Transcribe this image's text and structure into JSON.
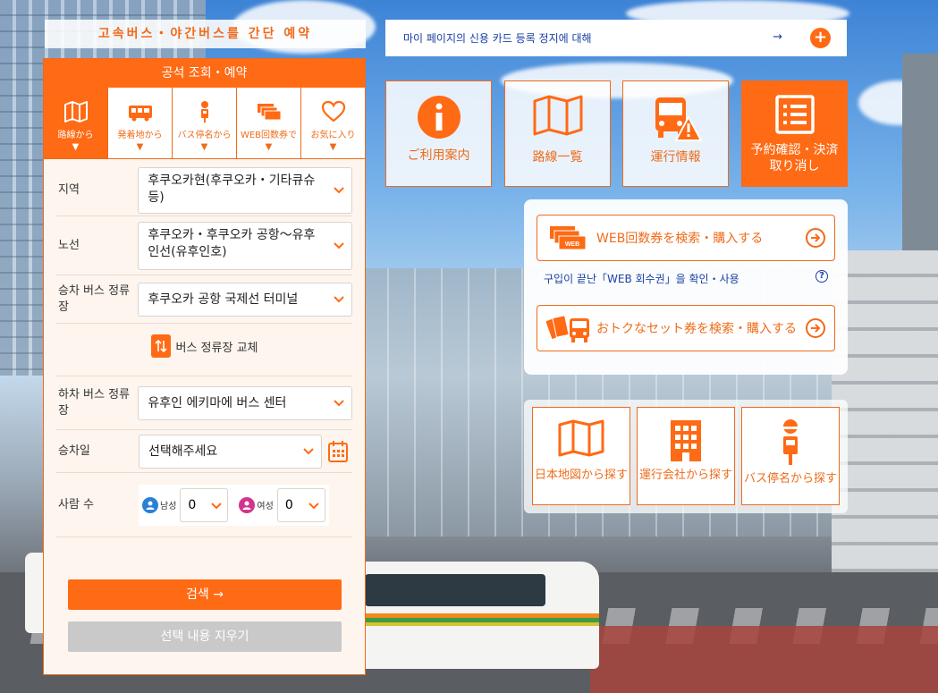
{
  "banner_left": "고속버스・야간버스를 간단 예약",
  "panel": {
    "title": "공석 조회・예약",
    "tabs": [
      {
        "label": "路線から",
        "icon": "map-icon"
      },
      {
        "label": "発着地から",
        "icon": "bus-icon"
      },
      {
        "label": "バス停名から",
        "icon": "bus-stop-icon"
      },
      {
        "label": "WEB回数券で",
        "icon": "tickets-icon"
      },
      {
        "label": "お気に入り",
        "icon": "heart-icon"
      }
    ],
    "tab_arrow": "▼",
    "fields": {
      "region_label": "지역",
      "region_value": "후쿠오카현(후쿠오카・기타큐슈 등)",
      "route_label": "노선",
      "route_value": "후쿠오카・후쿠오카 공항～유후인선(유후인호)",
      "board_label": "승차 버스 정류장",
      "board_value": "후쿠오카 공항 국제선 터미널",
      "swap_label": "버스 정류장 교체",
      "alight_label": "하차 버스 정류장",
      "alight_value": "유후인 에키마에 버스 센터",
      "date_label": "승차일",
      "date_value": "선택해주세요",
      "people_label": "사람 수",
      "male_label": "남성",
      "male_value": "0",
      "female_label": "여성",
      "female_value": "0"
    },
    "search_button": "검색 →",
    "clear_button": "선택 내용 지우기"
  },
  "notice": {
    "text": "마이 페이지의 신용 카드 등록 정지에 대해",
    "arrow": "→",
    "plus": "+"
  },
  "tiles": [
    {
      "label": "ご利用案内",
      "icon": "info-icon"
    },
    {
      "label": "路線一覧",
      "icon": "map-icon"
    },
    {
      "label": "運行情報",
      "icon": "bus-warning-icon"
    },
    {
      "label": "予約確認・決済取り消し",
      "icon": "list-icon"
    }
  ],
  "coupon": {
    "web_ticket_button": "WEB回数券を検索・購入する",
    "web_ticket_badge": "WEB",
    "confirm_link": "구입이 끝난「WEB 회수권」을 확인・사용",
    "help": "?",
    "set_ticket_button": "おトクなセット券を検索・購入する"
  },
  "search_tiles": [
    {
      "label": "日本地図から探す",
      "icon": "map-icon"
    },
    {
      "label": "運行会社から探す",
      "icon": "building-icon"
    },
    {
      "label": "バス停名から探す",
      "icon": "bus-stop-icon"
    }
  ],
  "colors": {
    "accent": "#ff6a14",
    "link": "#1a3fa6"
  }
}
